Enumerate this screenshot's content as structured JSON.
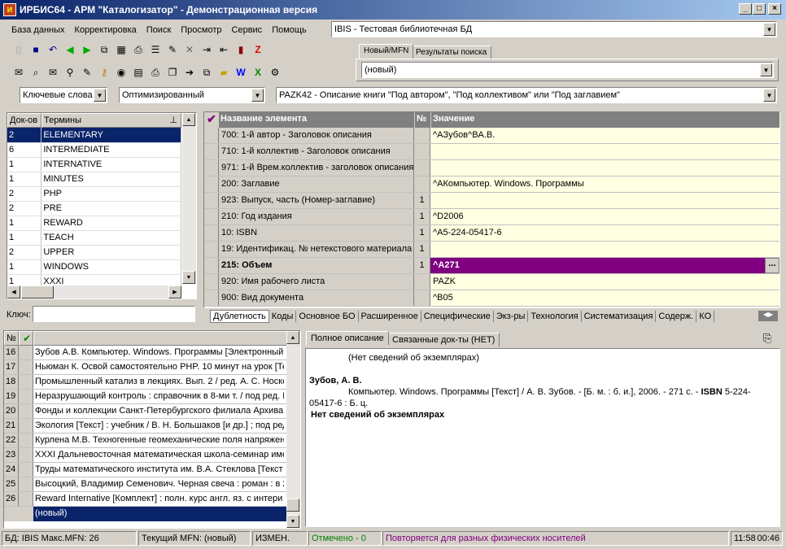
{
  "window": {
    "title": "ИРБИС64 - АРМ \"Каталогизатор\" - Демонстрационная версия"
  },
  "menu": [
    "База данных",
    "Корректировка",
    "Поиск",
    "Просмотр",
    "Сервис",
    "Помощь"
  ],
  "db_select": "IBIS - Тестовая библиотечная БД",
  "right_tabs": [
    "Новый/MFN",
    "Результаты поиска"
  ],
  "record_select": "(новый)",
  "search_mode": "Ключевые слова",
  "opt_mode": "Оптимизированный",
  "worksheet": "PAZK42 - Описание книги \"Под автором\", \"Под коллективом\" или \"Под заглавием\"",
  "dict": {
    "headers": [
      "Док-ов",
      "Термины"
    ],
    "rows": [
      [
        "2",
        "ELEMENTARY"
      ],
      [
        "6",
        "INTERMEDIATE"
      ],
      [
        "1",
        "INTERNATIVE"
      ],
      [
        "1",
        "MINUTES"
      ],
      [
        "2",
        "PHP"
      ],
      [
        "2",
        "PRE"
      ],
      [
        "1",
        "REWARD"
      ],
      [
        "1",
        "TEACH"
      ],
      [
        "2",
        "UPPER"
      ],
      [
        "1",
        "WINDOWS"
      ],
      [
        "1",
        "XXXI"
      ]
    ],
    "key_label": "Ключ:"
  },
  "editor": {
    "headers": [
      "Название элемента",
      "№",
      "Значение"
    ],
    "rows": [
      [
        "700: 1-й автор - Заголовок описания",
        "",
        "^AЗубов^BА.В."
      ],
      [
        "710: 1-й коллектив - Заголовок описания",
        "",
        ""
      ],
      [
        "971: 1-й Врем.коллектив - заголовок описания",
        "",
        ""
      ],
      [
        "200: Заглавие",
        "",
        "^AКомпьютер. Windows. Программы"
      ],
      [
        "923: Выпуск, часть (Номер-заглавие)",
        "1",
        ""
      ],
      [
        "210: Год издания",
        "1",
        "^D2006"
      ],
      [
        "10: ISBN",
        "1",
        "^A5-224-05417-6"
      ],
      [
        "19: Идентификац. № нетекстового материала",
        "1",
        ""
      ],
      [
        "215: Объем",
        "1",
        "^A271"
      ],
      [
        "920: Имя рабочего листа",
        "",
        "PAZK"
      ],
      [
        "900: Вид документа",
        "",
        "^B05"
      ]
    ],
    "ellipsis": "...",
    "tabs": [
      "Дублетность",
      "Коды",
      "Основное БО",
      "Расширенное",
      "Специфические",
      "Экз-ры",
      "Технология",
      "Систематизация",
      "Содерж.",
      "КО"
    ]
  },
  "results": {
    "header": "№",
    "rows": [
      [
        "16",
        "Зубов А.В. Компьютер. Windows. Программы [Электронный"
      ],
      [
        "17",
        "Ньюман К. Освой самостоятельно PHP. 10 минут на урок [Те"
      ],
      [
        "18",
        "Промышленный катализ в лекциях. Вып. 2 / ред. А. С. Носко"
      ],
      [
        "19",
        "Неразрушающий контроль : справочник в 8-ми т. / под ред. В"
      ],
      [
        "20",
        "Фонды и коллекции Санкт-Петербургского филиала Архива Р"
      ],
      [
        "21",
        "Экология [Текст] : учебник / В. Н. Большаков [и др.] ; под ред"
      ],
      [
        "22",
        "Курлена М.В. Техногенные геомеханические поля напряжен"
      ],
      [
        "23",
        "XXXI Дальневосточная математическая школа-семинар име"
      ],
      [
        "24",
        "Труды математического института им. В.А. Стеклова [Текст"
      ],
      [
        "25",
        "Высоцкий, Владимир Семенович. Черная свеча : роман : в 2"
      ],
      [
        "26",
        "Reward Internative [Комплект] : полн. курс англ. яз. с интери"
      ]
    ],
    "new_row": "(новый)"
  },
  "desc": {
    "tabs": [
      "Полное описание",
      "Связанные док-ты (НЕТ)"
    ],
    "line1": "(Нет сведений об экземплярах)",
    "author": "Зубов, А. В.",
    "body1": "Компьютер. Windows. Программы [Текст] / А. В. Зубов. - [Б. м. : б. и.], 2006. - 271 с. - ",
    "isbn_label": "ISBN",
    "body2": " 5-224-05417-6 : Б. ц.",
    "line_bold": "Нет сведений об экземплярах"
  },
  "status": {
    "db": "БД: IBIS Макс.MFN: 26",
    "mfn": "Текущий MFN: (новый)",
    "changed": "ИЗМЕН.",
    "marked": "Отмечено - 0",
    "repeat": "Повторяется для разных физических носителей",
    "time": "11:58",
    "time2": "00:46"
  },
  "colors": {
    "title_start": "#0a246a",
    "selected": "#0a246a",
    "active_row": "#800080",
    "value_bg": "#ffffe1",
    "marked": "#008000",
    "repeat": "#800080"
  }
}
